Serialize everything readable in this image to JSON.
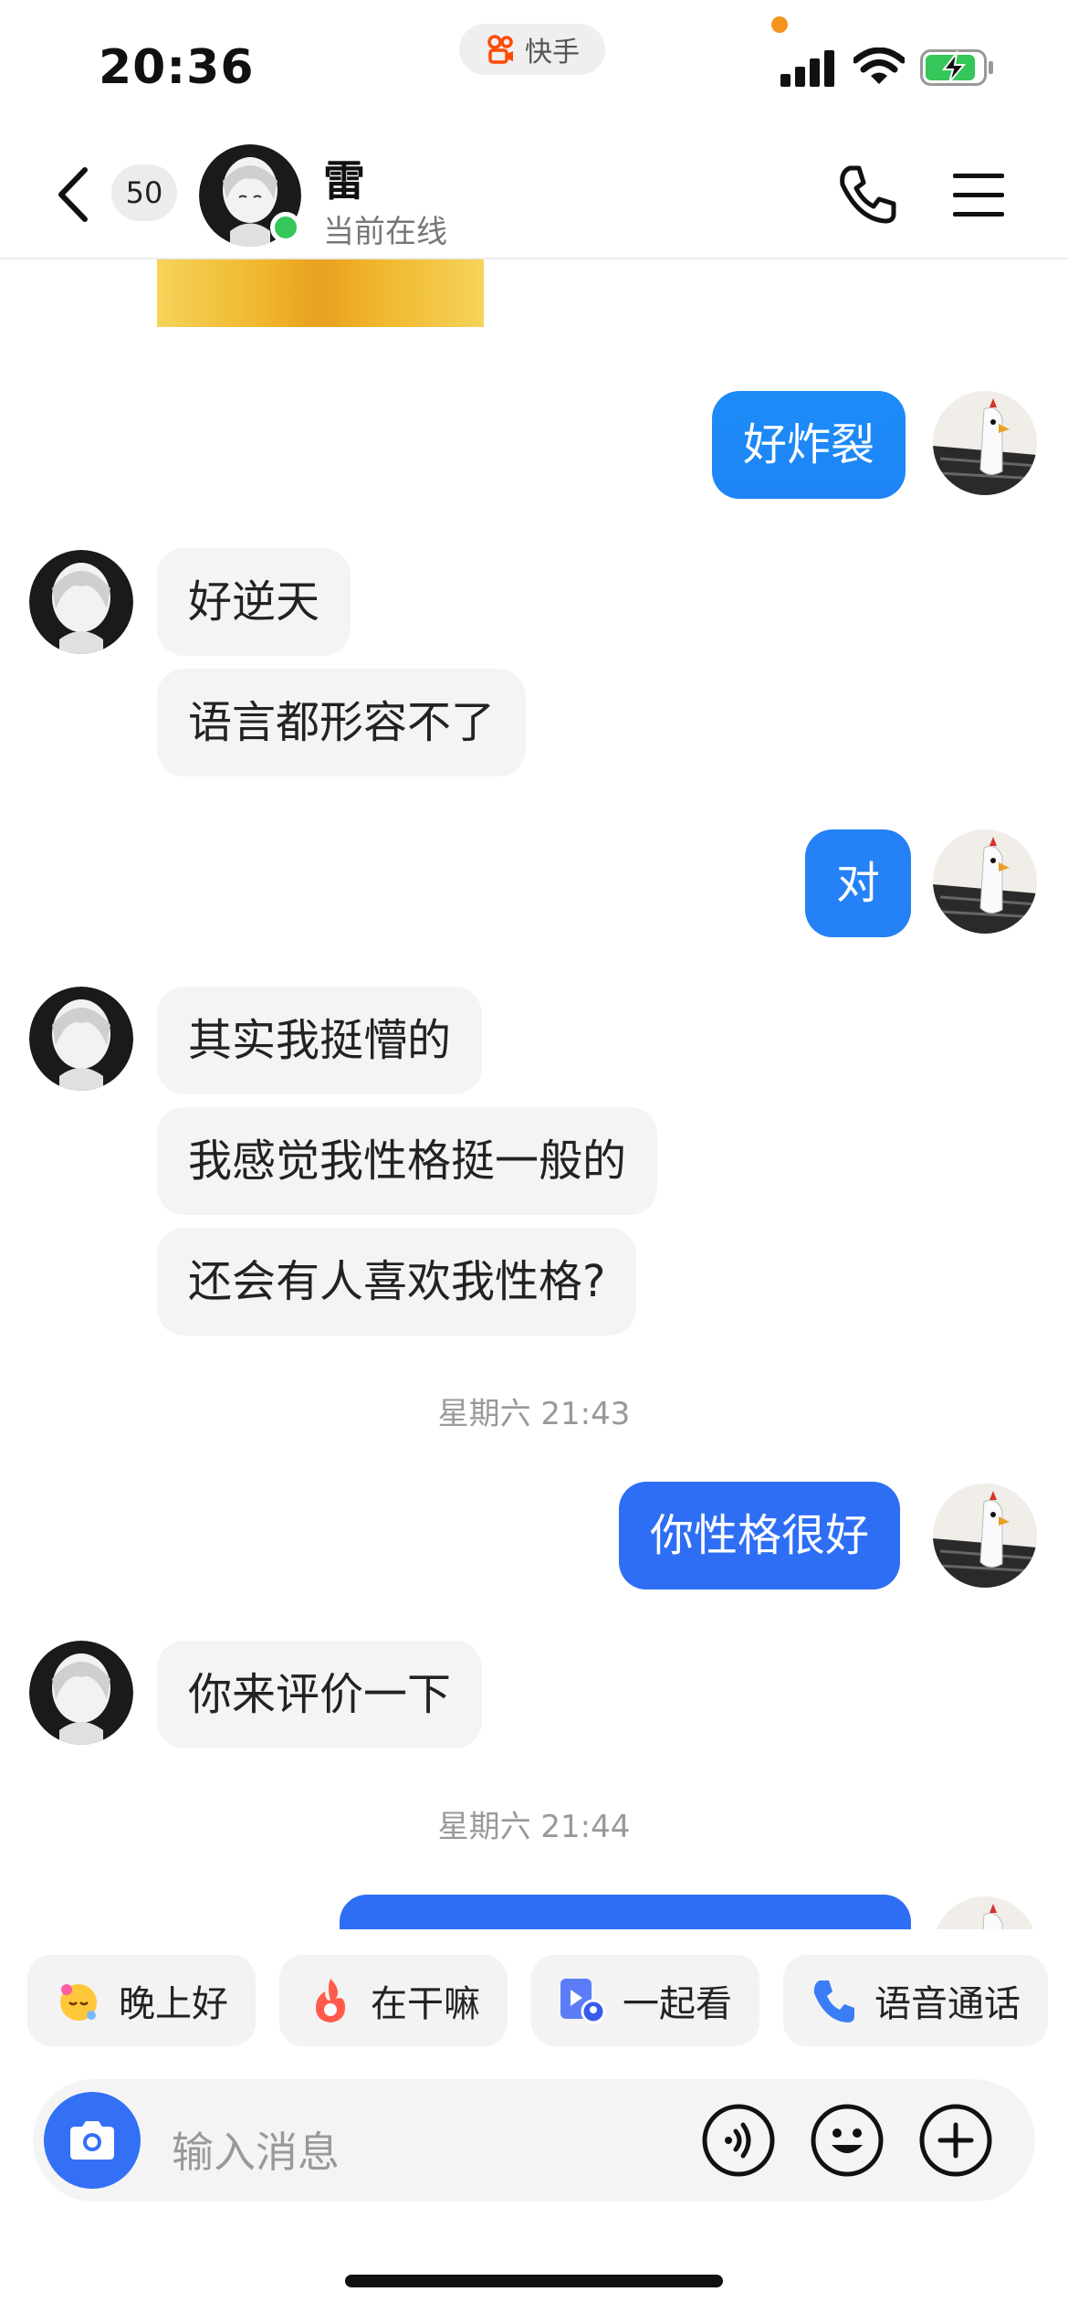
{
  "status_bar": {
    "time": "20:36",
    "app_name": "快手"
  },
  "header": {
    "unread_count": "50",
    "contact_name": "雷",
    "contact_status": "当前在线"
  },
  "messages": {
    "m1": "好炸裂",
    "m2": "好逆天",
    "m3": "语言都形容不了",
    "m4": "对",
    "m5": "其实我挺懵的",
    "m6": "我感觉我性格挺一般的",
    "m7": "还会有人喜欢我性格?",
    "ts1": "星期六 21:43",
    "m8": "你性格很好",
    "m9": "你来评价一下",
    "ts2": "星期六 21:44"
  },
  "quick_replies": [
    "晚上好",
    "在干嘛",
    "一起看",
    "语音通话"
  ],
  "input": {
    "placeholder": "输入消息"
  },
  "colors": {
    "accent_blue": "#3370f6",
    "out_bubble_top": "#1c8cf7",
    "out_bubble_bottom": "#2e6ef5",
    "online_green": "#35c759"
  }
}
